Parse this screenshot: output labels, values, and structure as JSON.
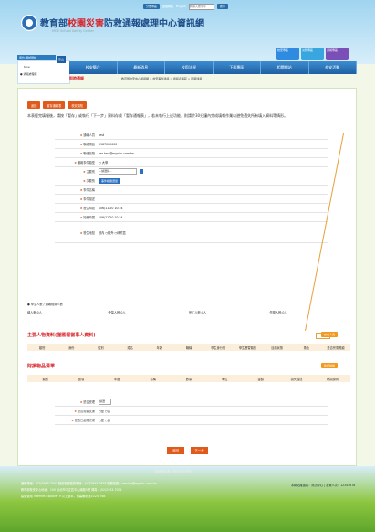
{
  "topbar": {
    "items": [
      "分眾專區",
      "雙語網站",
      "English"
    ],
    "search_placeholder": "請輸入搜尋字",
    "search_label": "搜尋"
  },
  "header": {
    "title_a": "教育部",
    "title_red": "校園災害",
    "title_b": "防救通報",
    "title_c": "處理中心資訊網",
    "subtitle": "MOE School Safety Center"
  },
  "quick_links": [
    {
      "label": "校安專區",
      "color": "#2e8be0"
    },
    {
      "label": "災防專區",
      "color": "#3aa6e0"
    },
    {
      "label": "通報專區",
      "color": "#7a4fb8"
    }
  ],
  "left_panel": {
    "user_label": "單位:測試學校",
    "id_label": "teoe",
    "login_label": "登出",
    "role": "● 通報處理者"
  },
  "nav": [
    "校安簡介",
    "最新消息",
    "校園法規",
    "下載專區",
    "相關網站",
    "校安活動"
  ],
  "breadcrumb": "首頁 > 校安通報",
  "section_title": "即時通報",
  "breadcrumb_path": "教育部校安中心通報網 > 校安事件通報 > 通報表填寫 > 即時通報",
  "buttons": [
    "返回",
    "暫存通報表",
    "校安須知"
  ],
  "notice": "本表經完填報後，請按「暫存」或執行「下一步」資料存成「暫存通報表」，若未執行上述功能，則請於30分鐘內完成填報作業以避免遺失所有填入資料等情形。",
  "form": [
    {
      "label": "通報人員",
      "value": "test"
    },
    {
      "label": "聯絡電話",
      "value": "0987000000"
    },
    {
      "label": "聯絡信箱",
      "value": "teo.test@mynhc.com.tw"
    },
    {
      "label": "通報事件類型",
      "value": "○ 大學"
    },
    {
      "label": "主要別",
      "value": "--請選擇--"
    },
    {
      "label": "次要別",
      "value": "事件相關選單"
    },
    {
      "label": "事件名稱",
      "value": ""
    },
    {
      "label": "事件描述",
      "value": ""
    },
    {
      "label": "發生時間",
      "value": "106/11/20 10:24"
    },
    {
      "label": "知悉時間",
      "value": "106/11/20 10:24"
    },
    {
      "label": "發生地點",
      "value": "校內 ○校外 ○研究區"
    }
  ],
  "school_info": {
    "head": "● 學生人數 / 通報相關人數",
    "cols": [
      "總人數:0人",
      "受傷人數:0人",
      "死亡人數:0人",
      "失蹤人數:0人"
    ]
  },
  "section1": {
    "title": "主要人物資料(僅匯報當事人資料)",
    "button": "新增人員",
    "cols": [
      "類別",
      "身份",
      "性別",
      "姓名",
      "年齡",
      "職稱",
      "學生身分別",
      "學生實習類別",
      "目前狀態",
      "角色",
      "是否會需照顧"
    ]
  },
  "section2": {
    "title": "財損物品清單",
    "button": "新增財損",
    "cols": [
      "類別",
      "品項",
      "年度",
      "名稱",
      "數量",
      "單位",
      "金額",
      "損失描述",
      "財損說明"
    ]
  },
  "bottom_form": [
    {
      "label": "是否受理",
      "value": "請選"
    },
    {
      "label": "是否需要支援",
      "value": "○是 ○否"
    },
    {
      "label": "是否已處理完成",
      "value": "○是 ○否"
    }
  ],
  "footer_buttons": [
    "返回",
    "下一步"
  ],
  "footer": {
    "top_links": "[隱私權政策]  [網站安全政策]",
    "line1": "通報專線：(02)2943-7002  校安相關諮詢專線：(02)2943-0678  服務信箱：service@mynhc.com.tw",
    "line2": "教育部校安中心地址：100 台北市中正區中山南路5號  傳真：(02)2943-7002",
    "line3": "建議使用 Internet Explorer 9 以上版本，螢幕解析度1024*768",
    "right": "本網站維護者：資訊中心 | 瀏覽人次：12345678"
  }
}
